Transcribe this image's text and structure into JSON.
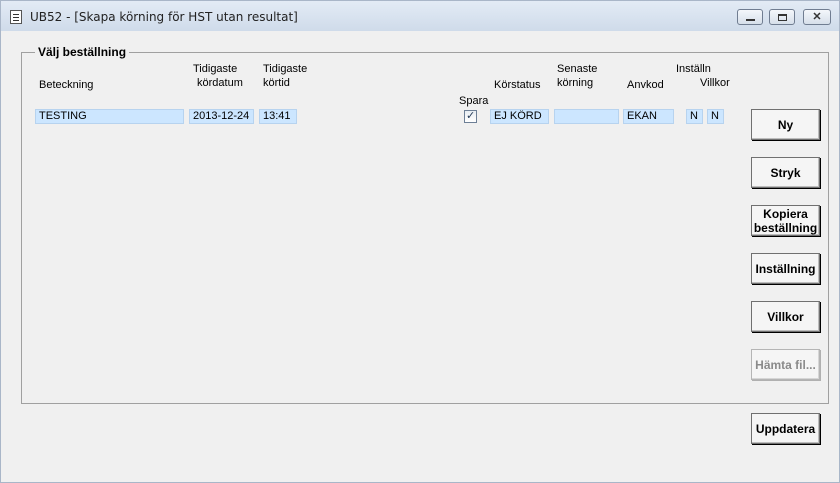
{
  "window": {
    "title": "UB52 - [Skapa körning för HST utan resultat]",
    "close_glyph": "✕"
  },
  "group": {
    "title": "Välj beställning"
  },
  "headers": {
    "beteckning": "Beteckning",
    "tidigaste_kordatum_1": "Tidigaste",
    "tidigaste_kordatum_2": "kördatum",
    "tidigaste_kortid_1": "Tidigaste",
    "tidigaste_kortid_2": "körtid",
    "spara": "Spara",
    "korstatus": "Körstatus",
    "senaste_korning_1": "Senaste",
    "senaste_korning_2": "körning",
    "anvkod": "Anvkod",
    "installn": "Inställn",
    "villkor": "Villkor"
  },
  "row": {
    "beteckning": "TESTING",
    "kordatum": "2013-12-24",
    "kortid": "13:41",
    "spara_checked": true,
    "spara_glyph": "✓",
    "korstatus": "EJ KÖRD",
    "senaste_korning": "",
    "anvkod": "EKAN",
    "installn": "N",
    "villkor": "N"
  },
  "buttons": {
    "ny": "Ny",
    "stryk": "Stryk",
    "kopiera_1": "Kopiera",
    "kopiera_2": "beställning",
    "installning": "Inställning",
    "villkor": "Villkor",
    "hamta_fil": "Hämta fil...",
    "uppdatera": "Uppdatera"
  },
  "colors": {
    "field_bg": "#cce6ff",
    "window_bg": "#f0f0f0",
    "titlebar": "#dbe4f0"
  }
}
